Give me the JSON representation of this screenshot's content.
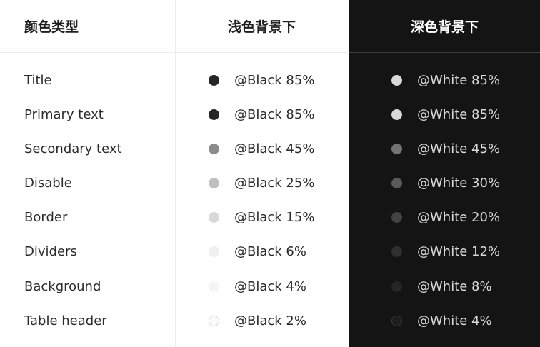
{
  "headers": {
    "type": "颜色类型",
    "light": "浅色背景下",
    "dark": "深色背景下"
  },
  "rows": [
    {
      "label": "Title",
      "light_text": "@Black 85%",
      "light_color": "#262626",
      "dark_text": "@White 85%",
      "dark_color": "#d9d9d9"
    },
    {
      "label": "Primary text",
      "light_text": "@Black 85%",
      "light_color": "#262626",
      "dark_text": "@White 85%",
      "dark_color": "#d9d9d9"
    },
    {
      "label": "Secondary text",
      "light_text": "@Black 45%",
      "light_color": "#8c8c8c",
      "dark_text": "@White 45%",
      "dark_color": "#737373"
    },
    {
      "label": "Disable",
      "light_text": "@Black 25%",
      "light_color": "#bfbfbf",
      "dark_text": "@White 30%",
      "dark_color": "#5a5a5a"
    },
    {
      "label": "Border",
      "light_text": "@Black 15%",
      "light_color": "#d9d9d9",
      "dark_text": "@White 20%",
      "dark_color": "#434343"
    },
    {
      "label": "Dividers",
      "light_text": "@Black 6%",
      "light_color": "#f0f0f0",
      "dark_text": "@White 12%",
      "dark_color": "#303030"
    },
    {
      "label": "Background",
      "light_text": "@Black 4%",
      "light_color": "#f5f5f5",
      "dark_text": "@White 8%",
      "dark_color": "#262626"
    },
    {
      "label": "Table header",
      "light_text": "@Black 2%",
      "light_color": "#fafafa",
      "dark_text": "@White 4%",
      "dark_color": "#1d1d1d"
    }
  ]
}
